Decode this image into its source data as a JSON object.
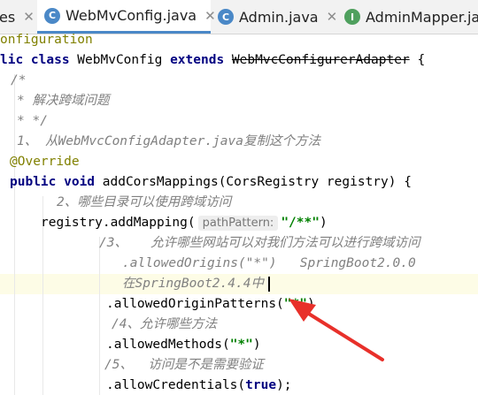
{
  "colors": {
    "tab_accent": "#4a88c7",
    "arrow": "#e8302a",
    "class_icon": "#4a88c7",
    "interface_icon": "#4fa05e"
  },
  "tabs": [
    {
      "label": "es",
      "icon": "",
      "active": false
    },
    {
      "label": "WebMvConfig.java",
      "icon": "C",
      "active": true
    },
    {
      "label": "Admin.java",
      "icon": "C",
      "active": false
    },
    {
      "label": "AdminMapper.java",
      "icon": "I",
      "active": false
    }
  ],
  "code": {
    "l1": "onfiguration",
    "l2_kw1": "lic class",
    "l2_name": " WebMvConfig ",
    "l2_kw2": "extends",
    "l2_super": "WebMvcConfigurerAdapter",
    "l2_brace": " {",
    "l3": "/*",
    "l4": "* 解决跨域问题",
    "l5": "* */",
    "l6": "1、 从WebMvcConfigAdapter.java复制这个方法",
    "l7": "@Override",
    "l8_kw": "public void",
    "l8_rest": " addCorsMappings(CorsRegistry registry) {",
    "l9": "2、哪些目录可以使用跨域访问",
    "l10_call": "registry.addMapping(",
    "l10_hint": "pathPattern:",
    "l10_str": "\"/**\"",
    "l10_end": ")",
    "l11": "/3、   允许哪些网站可以对我们方法可以进行跨域访问",
    "l12": ".allowedOrigins(\"*\")   SpringBoot2.0.0",
    "l13": "在SpringBoot2.4.4中",
    "l14_call": ".allowedOriginPatterns(",
    "l14_str": "\"*\"",
    "l14_end": ")",
    "l15": "/4、允许哪些方法",
    "l16_call": ".allowedMethods(",
    "l16_str": "\"*\"",
    "l16_end": ")",
    "l17": "/5、  访问是不是需要验证",
    "l18_call": ".allowCredentials(",
    "l18_kw": "true",
    "l18_end": ");"
  }
}
